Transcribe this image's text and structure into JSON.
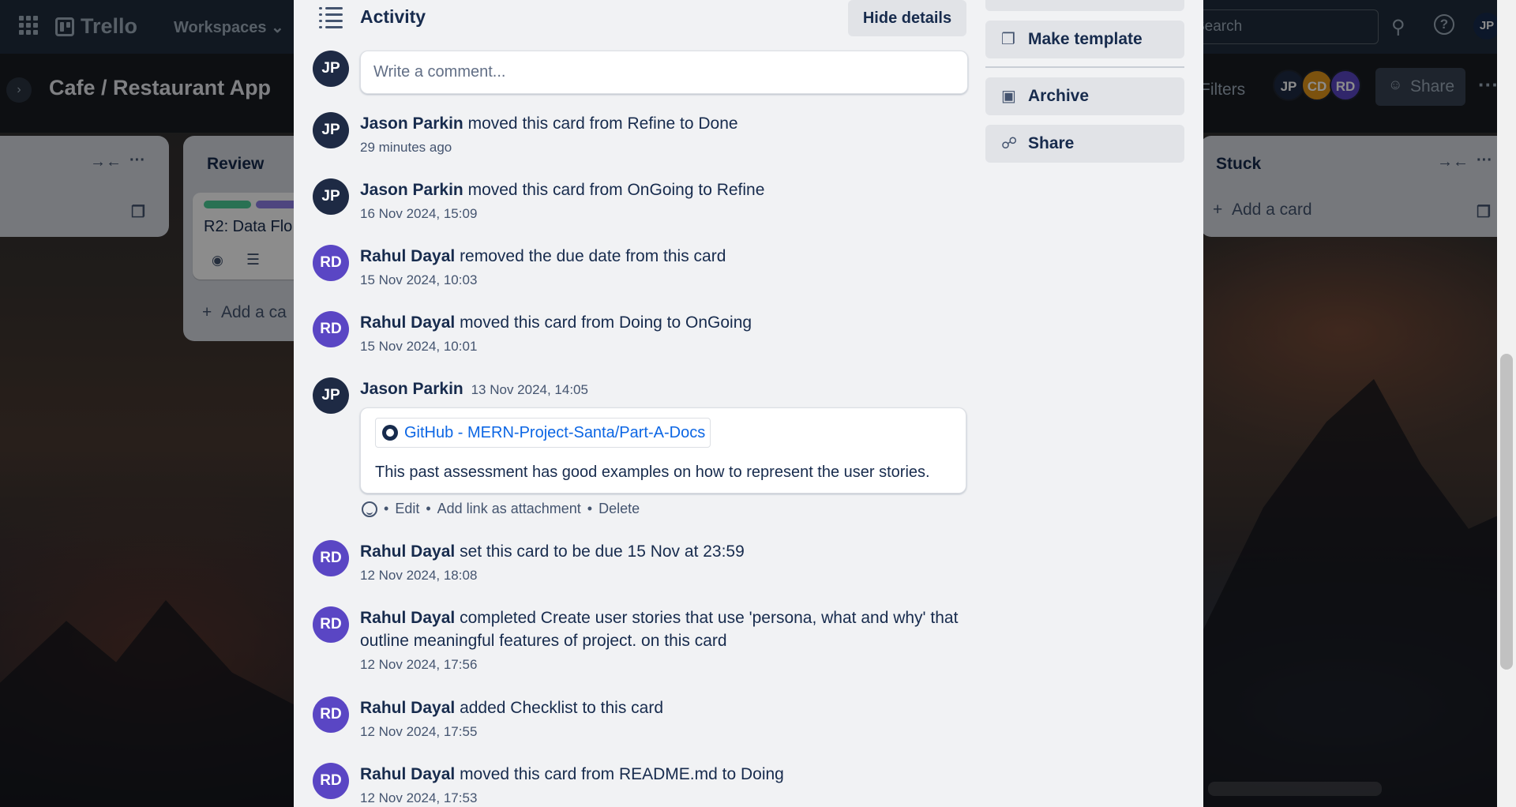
{
  "app": {
    "name": "Trello",
    "workspaces_label": "Workspaces",
    "search_placeholder": "Search"
  },
  "board": {
    "title": "Cafe / Restaurant App",
    "filters_label": "Filters",
    "share_label": "Share",
    "members": [
      {
        "initials": "JP",
        "color": "#1e2a44"
      },
      {
        "initials": "CD",
        "color": "#e2961a"
      },
      {
        "initials": "RD",
        "color": "#5a46c4"
      }
    ],
    "me_initials": "JP",
    "lists": {
      "review": {
        "title": "Review",
        "card_title": "R2: Data Flo",
        "add_card": "Add a ca"
      },
      "stuck": {
        "title": "Stuck",
        "add_card": "Add a card"
      }
    }
  },
  "activity": {
    "title": "Activity",
    "hide_details": "Hide details",
    "comment_placeholder": "Write a comment...",
    "current_user_initials": "JP",
    "entries": [
      {
        "initials": "JP",
        "user": "Jason Parkin",
        "text": "moved this card from Refine to Done",
        "time": "29 minutes ago"
      },
      {
        "initials": "JP",
        "user": "Jason Parkin",
        "text": "moved this card from OnGoing to Refine",
        "time": "16 Nov 2024, 15:09"
      },
      {
        "initials": "RD",
        "user": "Rahul Dayal",
        "text": "removed the due date from this card",
        "time": "15 Nov 2024, 10:03"
      },
      {
        "initials": "RD",
        "user": "Rahul Dayal",
        "text": "moved this card from Doing to OnGoing",
        "time": "15 Nov 2024, 10:01"
      },
      {
        "initials": "RD",
        "user": "Rahul Dayal",
        "text": "set this card to be due 15 Nov at 23:59",
        "time": "12 Nov 2024, 18:08"
      },
      {
        "initials": "RD",
        "user": "Rahul Dayal",
        "text": "completed Create user stories that use 'persona, what and why' that outline meaningful features of project. on this card",
        "time": "12 Nov 2024, 17:56"
      },
      {
        "initials": "RD",
        "user": "Rahul Dayal",
        "text": "added Checklist to this card",
        "time": "12 Nov 2024, 17:55"
      },
      {
        "initials": "RD",
        "user": "Rahul Dayal",
        "text": "moved this card from README.md to Doing",
        "time": "12 Nov 2024, 17:53"
      }
    ],
    "comment": {
      "initials": "JP",
      "user": "Jason Parkin",
      "time": "13 Nov 2024, 14:05",
      "link_text": "GitHub - MERN-Project-Santa/Part-A-Docs",
      "body": "This past assessment has good examples on how to represent the user stories.",
      "actions": {
        "edit": "Edit",
        "attach": "Add link as attachment",
        "delete": "Delete",
        "sep": "•"
      }
    }
  },
  "side_actions": {
    "make_template": "Make template",
    "archive": "Archive",
    "share": "Share"
  }
}
